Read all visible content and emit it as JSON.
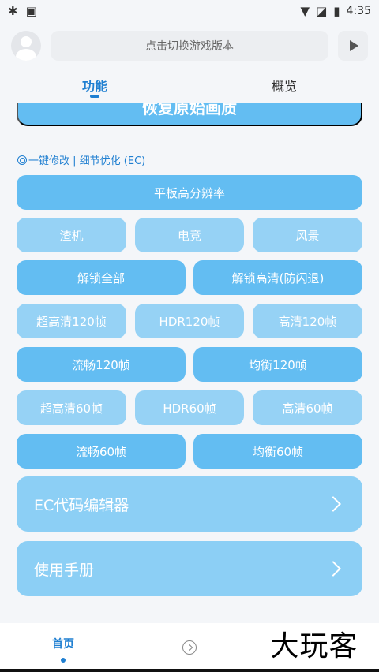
{
  "status_bar": {
    "time": "4:35"
  },
  "header": {
    "version_placeholder": "点击切换游戏版本"
  },
  "tabs": [
    {
      "label": "功能"
    },
    {
      "label": "概览"
    }
  ],
  "restore_button": "恢复原始画质",
  "section_header": "一键修改 | 细节优化 (EC)",
  "buttons": {
    "tablet_res": "平板高分辨率",
    "low": "渣机",
    "esports": "电竞",
    "scenery": "风景",
    "unlock_all": "解锁全部",
    "unlock_hd": "解锁高清(防闪退)",
    "uhd120": "超高清120帧",
    "hdr120": "HDR120帧",
    "hd120": "高清120帧",
    "smooth120": "流畅120帧",
    "balanced120": "均衡120帧",
    "uhd60": "超高清60帧",
    "hdr60": "HDR60帧",
    "hd60": "高清60帧",
    "smooth60": "流畅60帧",
    "balanced60": "均衡60帧"
  },
  "nav_cards": [
    {
      "label": "EC代码编辑器"
    },
    {
      "label": "使用手册"
    }
  ],
  "bottom_nav": {
    "home": "首页"
  },
  "watermark": "大玩客",
  "colors": {
    "accent": "#1f7fd1",
    "button_dark": "#63bdf2",
    "button_light": "#96d2f5"
  }
}
